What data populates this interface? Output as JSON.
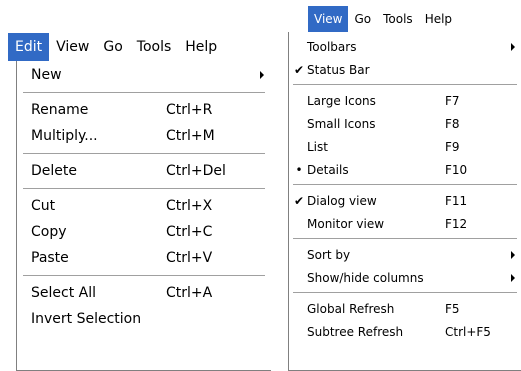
{
  "edit_window": {
    "menubar": [
      "Edit",
      "View",
      "Go",
      "Tools",
      "Help"
    ],
    "menu": {
      "new": "New",
      "rename": "Rename",
      "rename_key": "Ctrl+R",
      "multiply": "Multiply...",
      "multiply_key": "Ctrl+M",
      "delete": "Delete",
      "delete_key": "Ctrl+Del",
      "cut": "Cut",
      "cut_key": "Ctrl+X",
      "copy": "Copy",
      "copy_key": "Ctrl+C",
      "paste": "Paste",
      "paste_key": "Ctrl+V",
      "select_all": "Select All",
      "select_all_key": "Ctrl+A",
      "invert_selection": "Invert Selection"
    }
  },
  "view_window": {
    "menubar": [
      "View",
      "Go",
      "Tools",
      "Help"
    ],
    "menu": {
      "toolbars": "Toolbars",
      "status_bar": "Status Bar",
      "large_icons": "Large Icons",
      "large_icons_key": "F7",
      "small_icons": "Small Icons",
      "small_icons_key": "F8",
      "list": "List",
      "list_key": "F9",
      "details": "Details",
      "details_key": "F10",
      "dialog_view": "Dialog view",
      "dialog_view_key": "F11",
      "monitor_view": "Monitor view",
      "monitor_view_key": "F12",
      "sort_by": "Sort by",
      "show_hide_columns": "Show/hide columns",
      "global_refresh": "Global Refresh",
      "global_refresh_key": "F5",
      "subtree_refresh": "Subtree Refresh",
      "subtree_refresh_key": "Ctrl+F5"
    },
    "marks": {
      "check": "✔",
      "bullet": "•"
    }
  },
  "colors": {
    "highlight": "#316ac5",
    "separator": "#a0a0a0"
  },
  "icons": {
    "check": "check-icon",
    "bullet": "radio-bullet-icon",
    "submenu": "submenu-arrow-icon"
  }
}
